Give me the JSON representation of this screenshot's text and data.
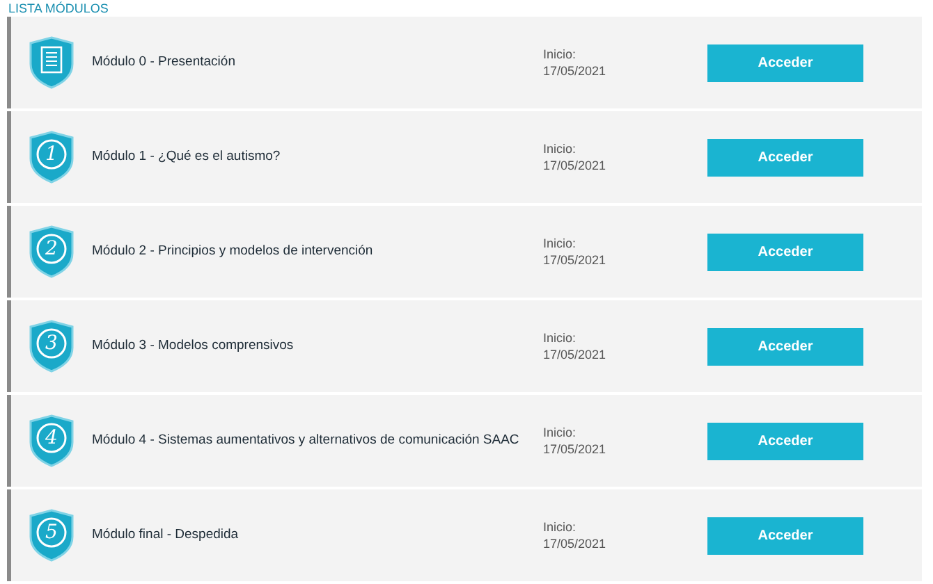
{
  "heading": "LISTA MÓDULOS",
  "modules": [
    {
      "kind": "document",
      "title": "Módulo 0 - Presentación",
      "start_label": "Inicio:",
      "start_date": "17/05/2021",
      "button": "Acceder"
    },
    {
      "kind": "number",
      "badge": "1",
      "title": "Módulo 1 - ¿Qué es el autismo?",
      "start_label": "Inicio:",
      "start_date": "17/05/2021",
      "button": "Acceder"
    },
    {
      "kind": "number",
      "badge": "2",
      "title": "Módulo 2 - Principios y modelos de intervención",
      "start_label": "Inicio:",
      "start_date": "17/05/2021",
      "button": "Acceder"
    },
    {
      "kind": "number",
      "badge": "3",
      "title": "Módulo 3 - Modelos comprensivos",
      "start_label": "Inicio:",
      "start_date": "17/05/2021",
      "button": "Acceder"
    },
    {
      "kind": "number",
      "badge": "4",
      "title": "Módulo 4 - Sistemas aumentativos y alternativos de comunicación SAAC",
      "start_label": "Inicio:",
      "start_date": "17/05/2021",
      "button": "Acceder"
    },
    {
      "kind": "number",
      "badge": "5",
      "title": "Módulo final - Despedida",
      "start_label": "Inicio:",
      "start_date": "17/05/2021",
      "button": "Acceder"
    }
  ]
}
